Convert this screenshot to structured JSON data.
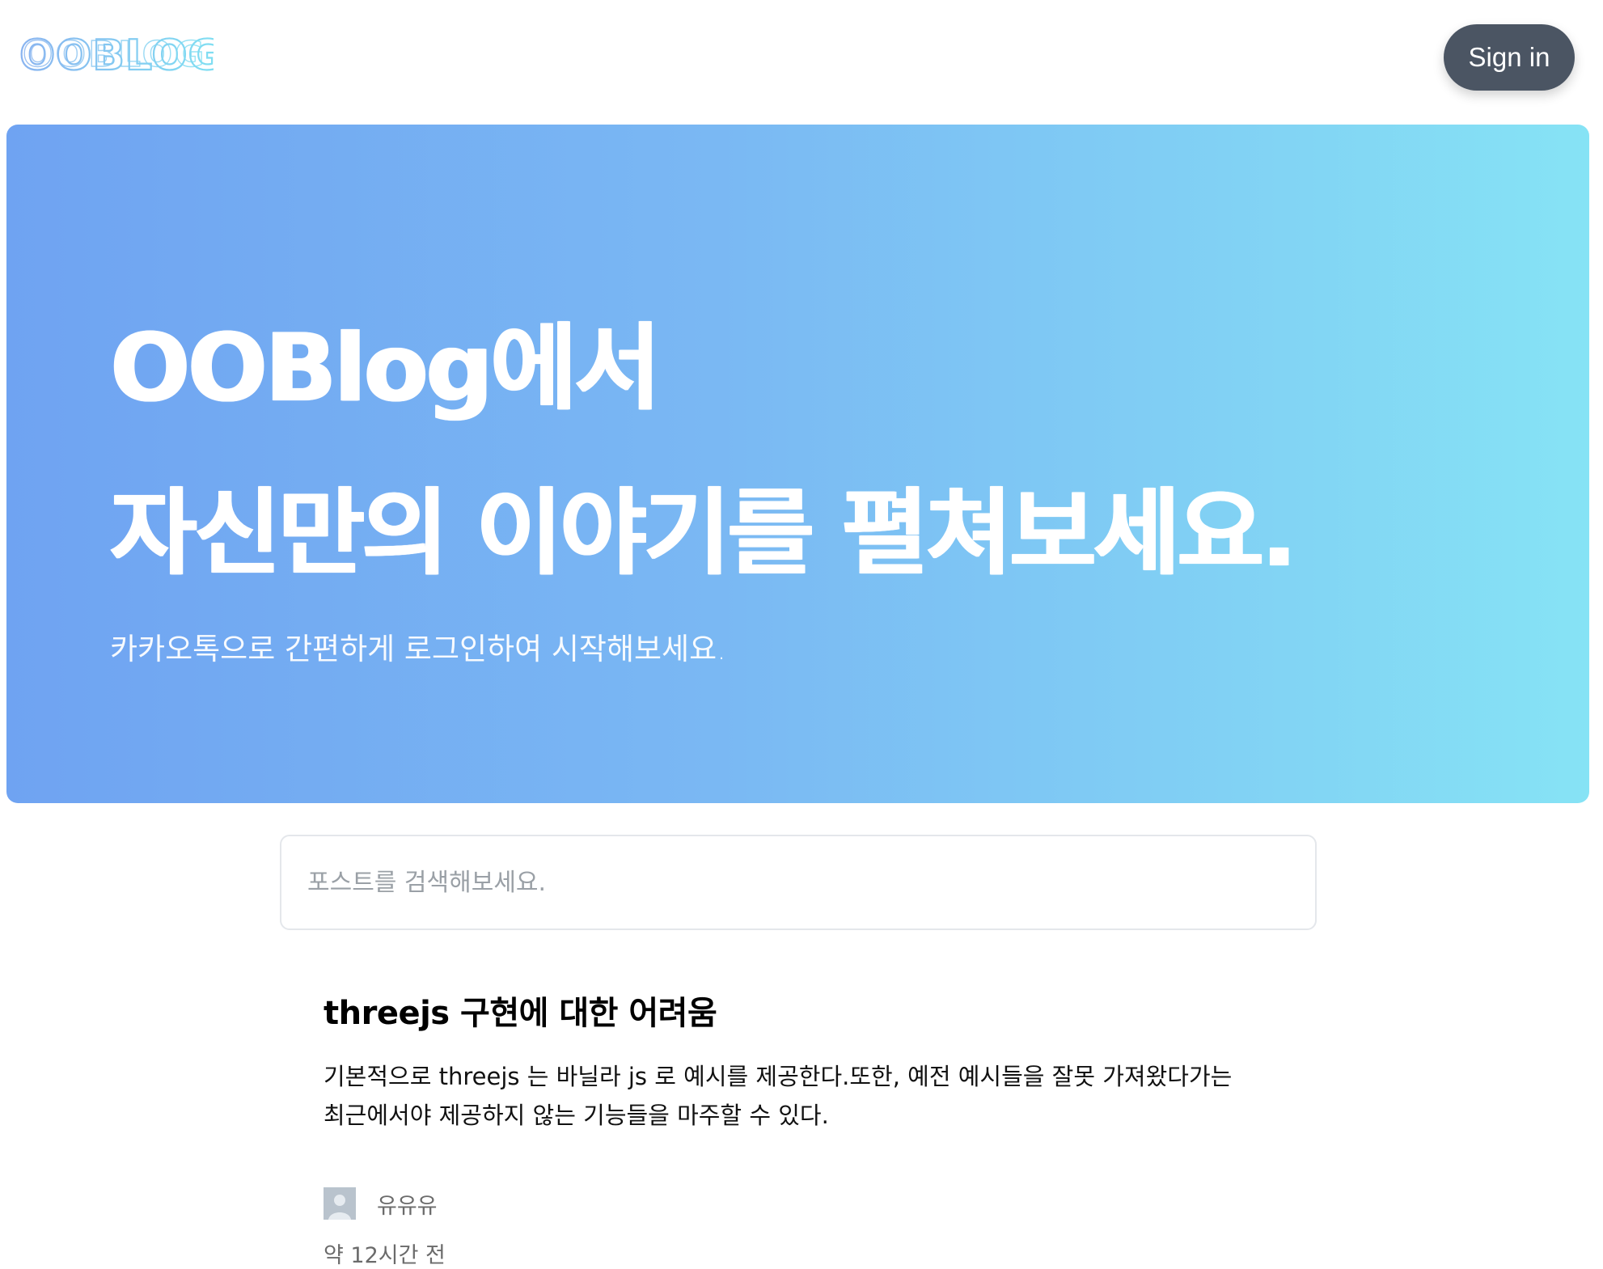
{
  "header": {
    "logo_text": "OOBLOG",
    "signin_label": "Sign in"
  },
  "hero": {
    "title_line1": "OOBlog에서",
    "title_line2": "자신만의 이야기를 펼쳐보세요.",
    "subtitle": "카카오톡으로 간편하게 로그인하여 시작해보세요."
  },
  "search": {
    "placeholder": "포스트를 검색해보세요."
  },
  "post": {
    "title": "threejs 구현에 대한 어려움",
    "excerpt_line1": "기본적으로 threejs 는 바닐라 js 로 예시를 제공한다.또한, 예전 예시들을 잘못 가져왔다가는",
    "excerpt_line2": "최근에서야 제공하지 않는 기능들을 마주할 수 있다.",
    "author": "유유유",
    "time": "약 12시간 전"
  },
  "colors": {
    "logo": "#7cc6f0",
    "signin_bg": "#4b5563",
    "hero_gradient_start": "#6fa3f2",
    "hero_gradient_end": "#86e3f5"
  },
  "icons": {
    "avatar": "user-avatar-icon"
  }
}
